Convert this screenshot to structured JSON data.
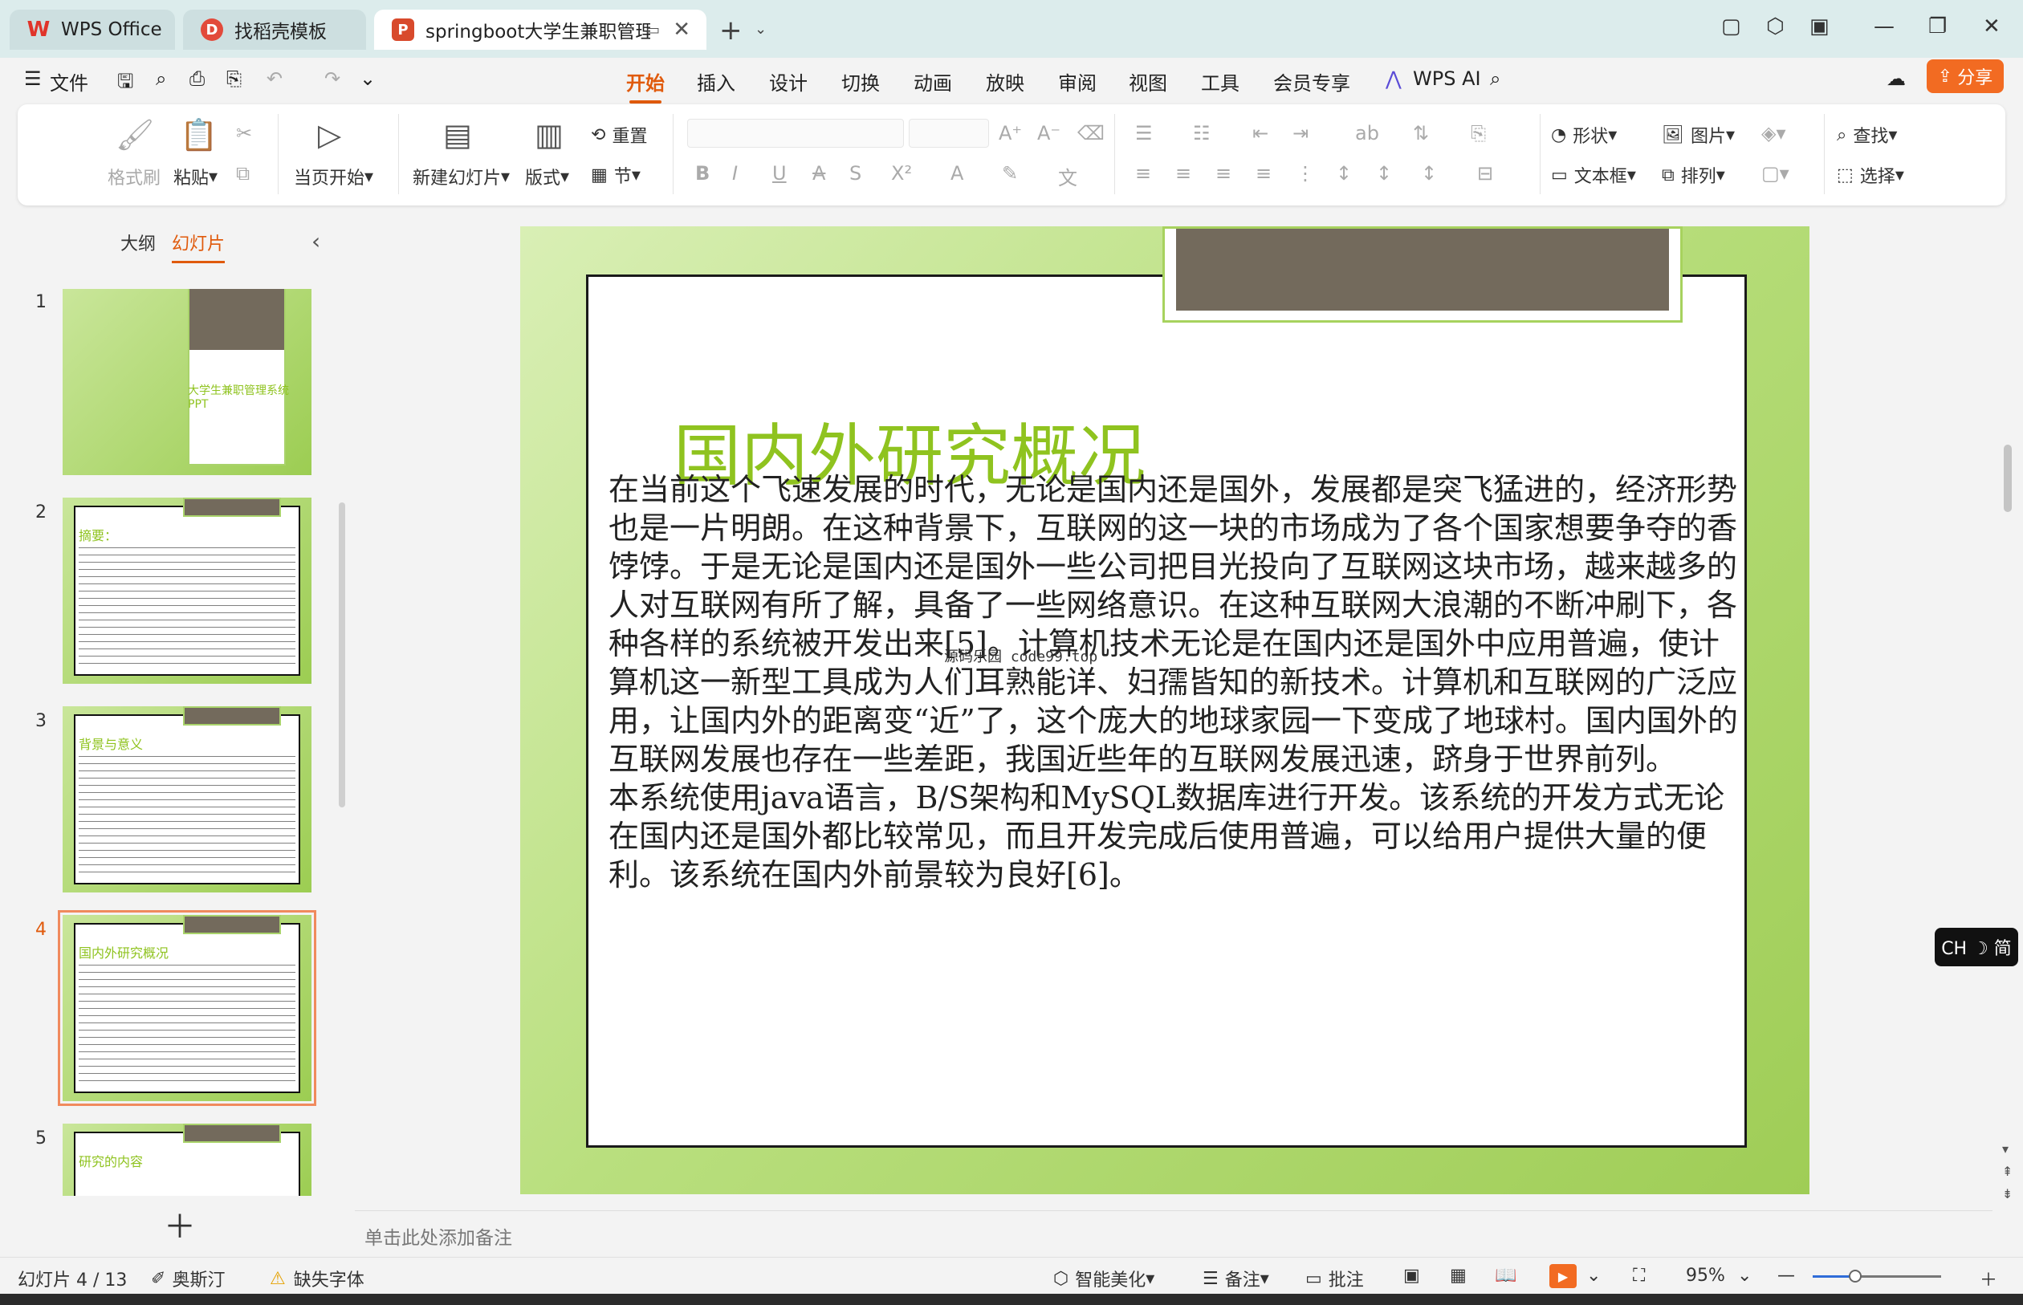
{
  "titlebar": {
    "tabs": [
      {
        "label": "WPS Office",
        "icon": "wps-logo-icon"
      },
      {
        "label": "找稻壳模板",
        "icon": "daoke-logo-icon"
      },
      {
        "label": "springboot大学生兼职管理系",
        "icon": "ppt-file-icon"
      }
    ],
    "new_tab": "+",
    "window_controls": [
      "minimize",
      "maximize",
      "close"
    ]
  },
  "menubar": {
    "file_label": "文件",
    "tabs": [
      "开始",
      "插入",
      "设计",
      "切换",
      "动画",
      "放映",
      "审阅",
      "视图",
      "工具",
      "会员专享"
    ],
    "active_tab": "开始",
    "ai_label": "WPS AI",
    "share_label": "分享"
  },
  "ribbon": {
    "format_painter": "格式刷",
    "paste": "粘贴",
    "from_current": "当页开始",
    "new_slide": "新建幻灯片",
    "layout": "版式",
    "reset": "重置",
    "section": "节",
    "shape": "形状",
    "picture": "图片",
    "textbox": "文本框",
    "arrange": "排列",
    "find": "查找",
    "select": "选择"
  },
  "panel": {
    "tab_outline": "大纲",
    "tab_slides": "幻灯片",
    "active": "幻灯片",
    "slides": [
      {
        "num": "1",
        "title": "大学生兼职管理系统PPT"
      },
      {
        "num": "2",
        "title": "摘要："
      },
      {
        "num": "3",
        "title": "背景与意义"
      },
      {
        "num": "4",
        "title": "国内外研究概况"
      },
      {
        "num": "5",
        "title": "研究的内容"
      }
    ],
    "selected_slide": "4"
  },
  "slide": {
    "title": "国内外研究概况",
    "paragraphs": [
      "在当前这个飞速发展的时代，无论是国内还是国外，发展都是突飞猛进的，经济形势也是一片明朗。在这种背景下，互联网的这一块的市场成为了各个国家想要争夺的香饽饽。于是无论是国内还是国外一些公司把目光投向了互联网这块市场，越来越多的人对互联网有所了解，具备了一些网络意识。在这种互联网大浪潮的不断冲刷下，各种各样的系统被开发出来[5]。计算机技术无论是在国内还是国外中应用普遍，使计算机这一新型工具成为人们耳熟能详、妇孺皆知的新技术。计算机和互联网的广泛应用，让国内外的距离变“近”了，这个庞大的地球家园一下变成了地球村。国内国外的互联网发展也存在一些差距，我国近些年的互联网发展迅速，跻身于世界前列。",
      "本系统使用java语言，B/S架构和MySQL数据库进行开发。该系统的开发方式无论在国内还是国外都比较常见，而且开发完成后使用普遍，可以给用户提供大量的便利。该系统在国内外前景较为良好[6]。"
    ],
    "watermark": "源码乐园 code99.top"
  },
  "notes": {
    "placeholder": "单击此处添加备注"
  },
  "ime": {
    "label": "CH ☽ 简"
  },
  "statusbar": {
    "slide_counter": "幻灯片 4 / 13",
    "theme": "奥斯汀",
    "missing_font": "缺失字体",
    "smart_beautify": "智能美化",
    "notes": "备注",
    "comment": "批注",
    "zoom": "95%",
    "zoom_level": 0.33
  },
  "colors": {
    "accent": "#e05a0c",
    "share": "#f26b22",
    "slide_title": "#8fc31f",
    "slide_tag": "#736a5c"
  }
}
